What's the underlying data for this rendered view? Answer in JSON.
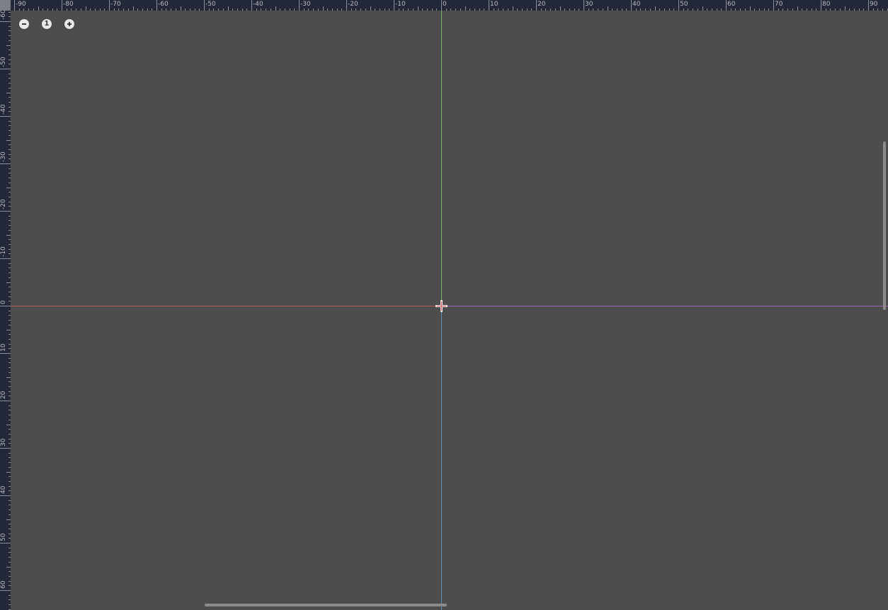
{
  "ruler_top": {
    "labels": [
      "-90",
      "-80",
      "-70",
      "-60",
      "-50",
      "-40",
      "-30",
      "-20",
      "-10",
      "0",
      "10",
      "20",
      "30",
      "40",
      "50",
      "60",
      "70",
      "80",
      "90"
    ]
  },
  "ruler_left": {
    "labels": [
      "-60",
      "-50",
      "-40",
      "-30",
      "-20",
      "-10",
      "0",
      "10",
      "20",
      "30",
      "40",
      "50",
      "60"
    ]
  },
  "zoom": {
    "reset_label": "1"
  },
  "icons": {
    "zoom_out": "minus-circle-icon",
    "zoom_reset": "one-circle-icon",
    "zoom_in": "plus-circle-icon",
    "origin": "crosshair-icon"
  },
  "colors": {
    "background": "#4d4d4d",
    "ruler_bg": "#232838",
    "axis_x_negative": "#b85a5e",
    "axis_x_positive": "#9a62b8",
    "axis_y_negative": "#76b06a",
    "axis_y_positive": "#5f92b8"
  }
}
